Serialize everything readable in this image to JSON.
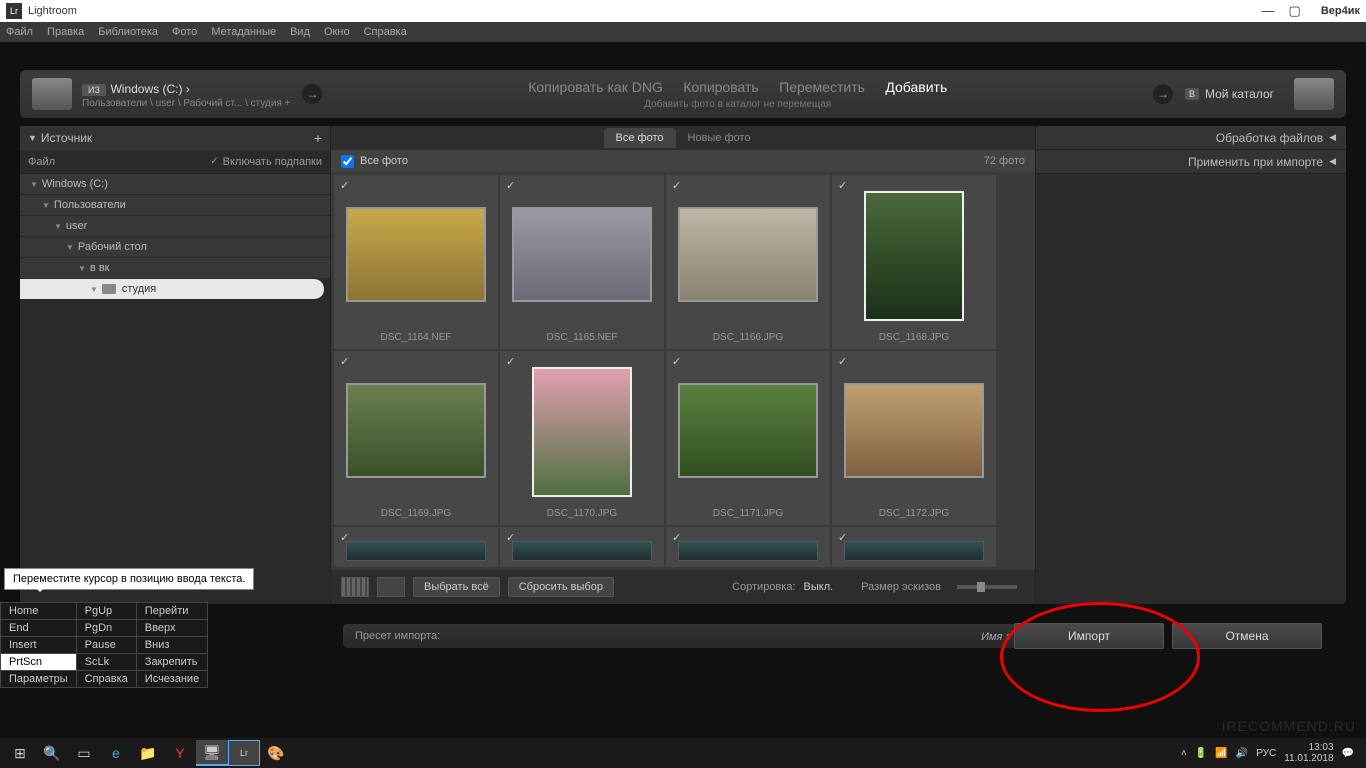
{
  "titlebar": {
    "app": "Lightroom",
    "user": "Вер4ик"
  },
  "menu": [
    "Файл",
    "Правка",
    "Библиотека",
    "Фото",
    "Метаданные",
    "Вид",
    "Окно",
    "Справка"
  ],
  "importTop": {
    "srcBadge": "ИЗ",
    "srcDrive": "Windows (C:) ›",
    "srcPath": "Пользователи \\ user \\ Рабочий ст... \\ студия +",
    "modes": {
      "dng": "Копировать как DNG",
      "copy": "Копировать",
      "move": "Переместить",
      "add": "Добавить"
    },
    "modeSub": "Добавить фото в каталог не перемещая",
    "dstBadge": "В",
    "dstLabel": "Мой каталог"
  },
  "left": {
    "header": "Источник",
    "fileLabel": "Файл",
    "includeSub": "Включать подпапки",
    "tree": [
      {
        "label": "Windows (C:)",
        "indent": 10
      },
      {
        "label": "Пользователи",
        "indent": 22
      },
      {
        "label": "user",
        "indent": 34
      },
      {
        "label": "Рабочий стол",
        "indent": 46
      },
      {
        "label": "в вк",
        "indent": 58
      },
      {
        "label": "студия",
        "indent": 70,
        "selected": true
      }
    ]
  },
  "center": {
    "tabs": {
      "all": "Все фото",
      "new": "Новые фото"
    },
    "headerLabel": "Все фото",
    "count": "72 фото",
    "thumbs": [
      {
        "name": "DSC_1164.NEF",
        "cls": "ph1",
        "orient": "landscape"
      },
      {
        "name": "DSC_1165.NEF",
        "cls": "ph2",
        "orient": "landscape"
      },
      {
        "name": "DSC_1166.JPG",
        "cls": "ph3",
        "orient": "landscape"
      },
      {
        "name": "DSC_1168.JPG",
        "cls": "ph4",
        "orient": "portrait"
      },
      {
        "name": "DSC_1169.JPG",
        "cls": "ph5",
        "orient": "landscape"
      },
      {
        "name": "DSC_1170.JPG",
        "cls": "ph6",
        "orient": "portrait"
      },
      {
        "name": "DSC_1171.JPG",
        "cls": "ph7",
        "orient": "landscape"
      },
      {
        "name": "DSC_1172.JPG",
        "cls": "ph8",
        "orient": "landscape"
      }
    ],
    "selectAll": "Выбрать всё",
    "deselect": "Сбросить выбор",
    "sortLabel": "Сортировка:",
    "sortVal": "Выкл.",
    "sizeLabel": "Размер эскизов"
  },
  "right": {
    "row1": "Обработка файлов",
    "row2": "Применить при импорте"
  },
  "preset": {
    "label": "Пресет импорта:",
    "val": "Имя ▾"
  },
  "actions": {
    "import": "Импорт",
    "cancel": "Отмена"
  },
  "tooltip": "Переместите курсор в позицию ввода текста.",
  "overlay": [
    [
      "Home",
      "PgUp",
      "Перейти"
    ],
    [
      "End",
      "PgDn",
      "Вверх"
    ],
    [
      "Insert",
      "Pause",
      "Вниз"
    ],
    [
      "PrtScn",
      "ScLk",
      "Закрепить"
    ],
    [
      "Параметры",
      "Справка",
      "Исчезание"
    ]
  ],
  "taskbar": {
    "time": "13:03",
    "date": "11.01.2018",
    "lang": "РУС"
  },
  "watermark": "IRECOMMEND.RU"
}
